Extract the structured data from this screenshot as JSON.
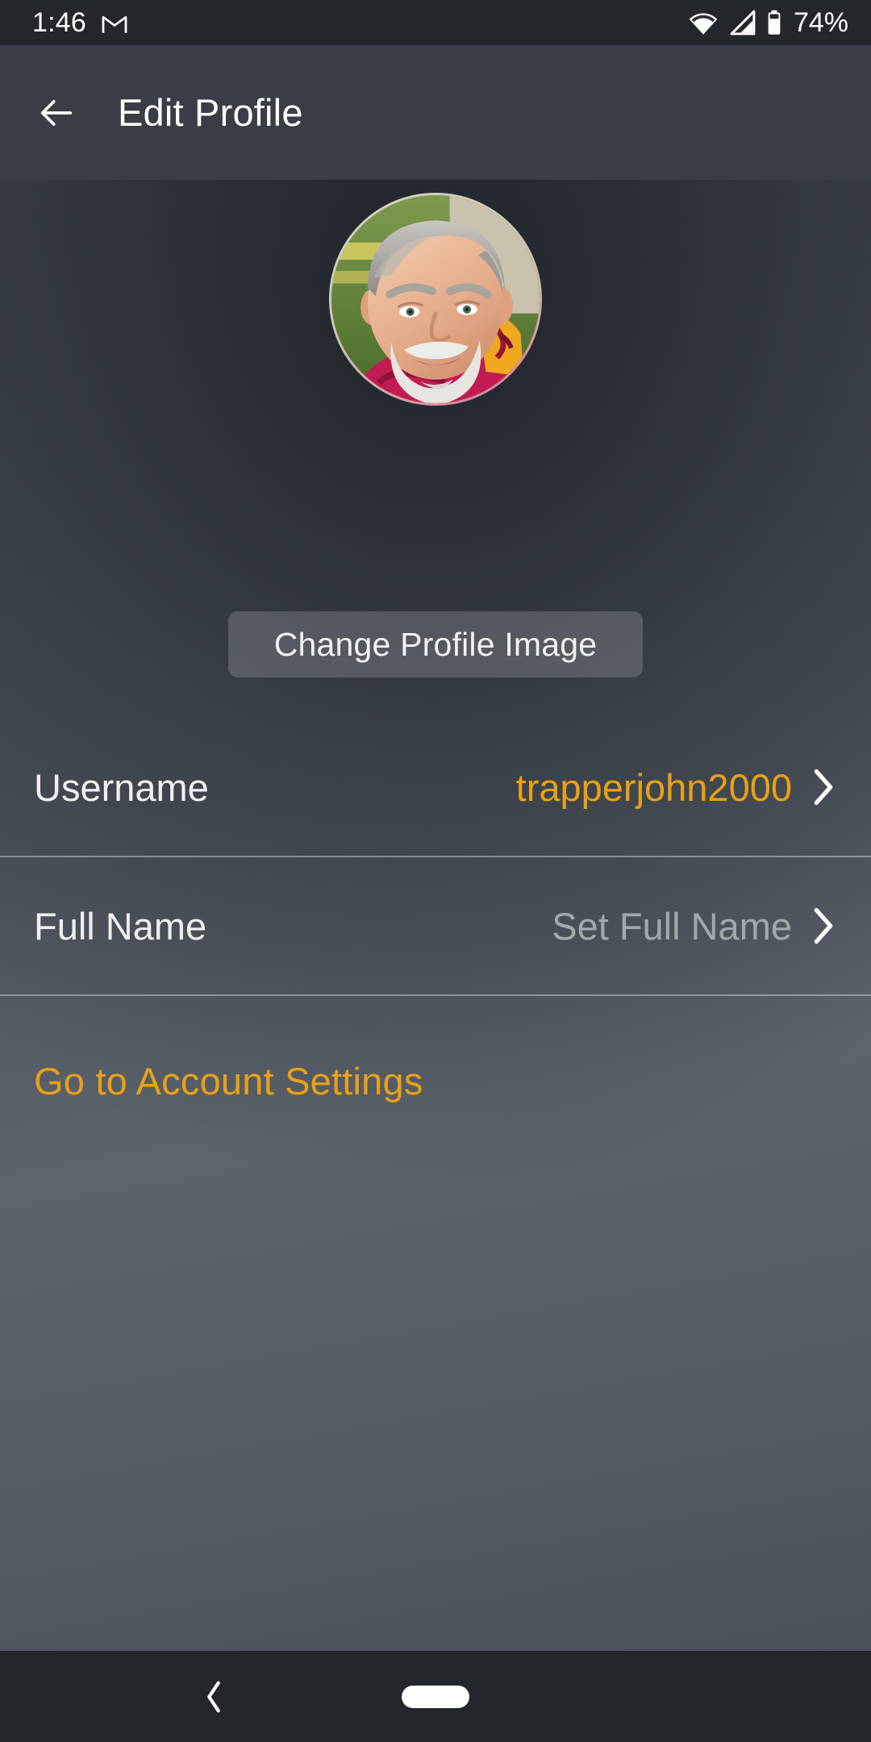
{
  "status_bar": {
    "time": "1:46",
    "mail_icon": "gmail-icon",
    "wifi_icon": "wifi-icon",
    "cellular_icon": "cellular-signal-icon",
    "battery_icon": "battery-icon",
    "battery_percent": "74%"
  },
  "app_bar": {
    "back_icon": "arrow-left-icon",
    "title": "Edit Profile"
  },
  "profile": {
    "avatar_alt": "profile-photo",
    "change_image_label": "Change Profile Image"
  },
  "rows": [
    {
      "label": "Username",
      "value": "trapperjohn2000",
      "value_style": "accent",
      "chevron_icon": "chevron-right-icon"
    },
    {
      "label": "Full Name",
      "value": "Set Full Name",
      "value_style": "muted",
      "chevron_icon": "chevron-right-icon"
    }
  ],
  "account_link": {
    "label": "Go to Account Settings"
  },
  "nav_bar": {
    "back_icon": "chevron-left-icon",
    "home_icon": "home-pill-icon"
  },
  "colors": {
    "accent": "#e8a117",
    "app_bar_bg": "#393d45",
    "system_bar_bg": "#23262b",
    "muted_text": "#a3a8ad",
    "primary_text": "#f0f0f0"
  }
}
